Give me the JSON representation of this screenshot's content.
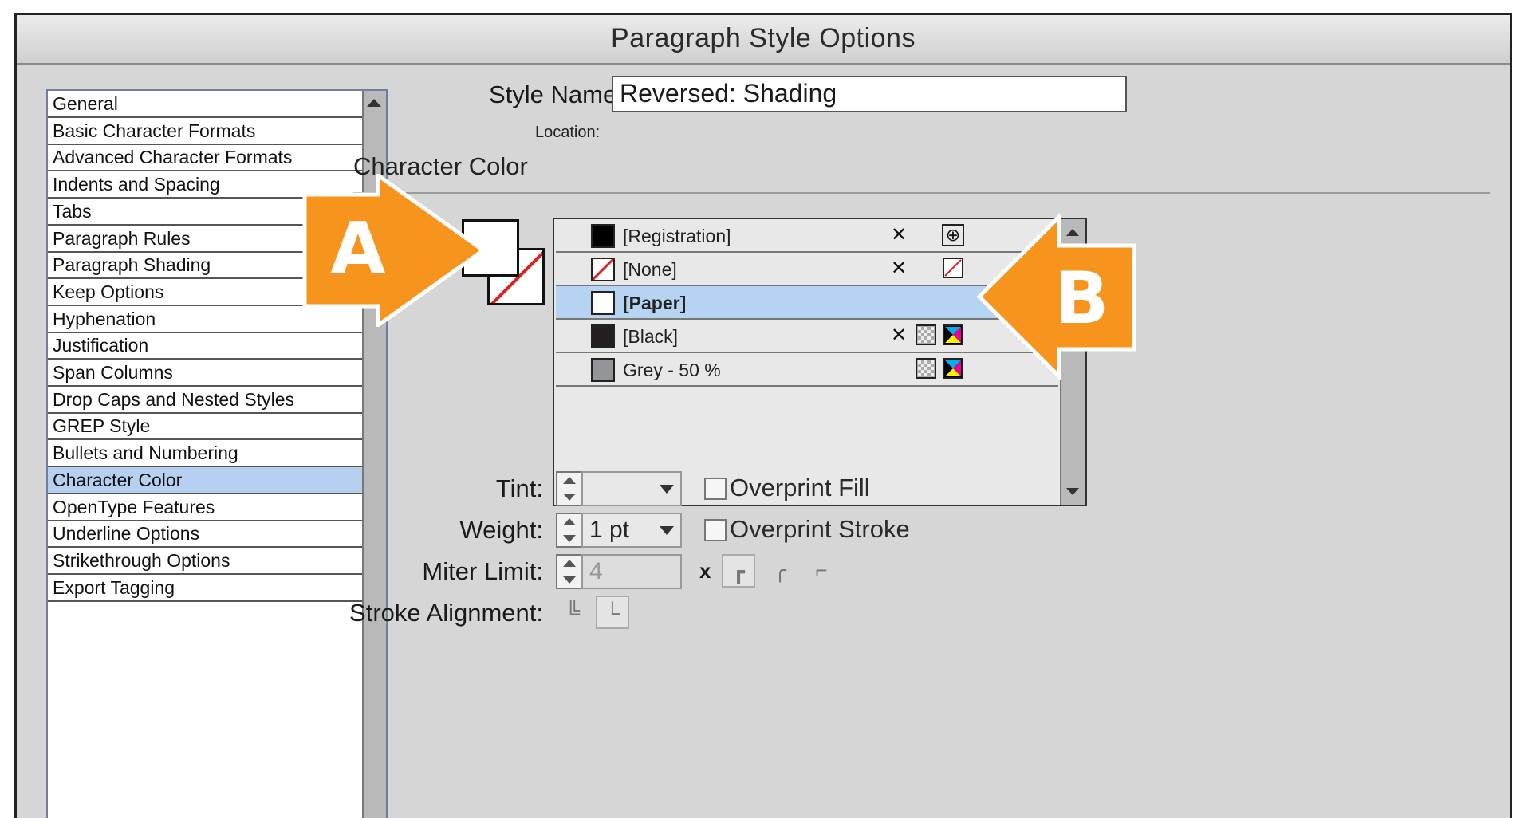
{
  "window": {
    "title": "Paragraph Style Options"
  },
  "sidebar": {
    "items": [
      {
        "label": "General"
      },
      {
        "label": "Basic Character Formats"
      },
      {
        "label": "Advanced Character Formats"
      },
      {
        "label": "Indents and Spacing"
      },
      {
        "label": "Tabs"
      },
      {
        "label": "Paragraph Rules"
      },
      {
        "label": "Paragraph Shading"
      },
      {
        "label": "Keep Options"
      },
      {
        "label": "Hyphenation"
      },
      {
        "label": "Justification"
      },
      {
        "label": "Span Columns"
      },
      {
        "label": "Drop Caps and Nested Styles"
      },
      {
        "label": "GREP Style"
      },
      {
        "label": "Bullets and Numbering"
      },
      {
        "label": "Character Color"
      },
      {
        "label": "OpenType Features"
      },
      {
        "label": "Underline Options"
      },
      {
        "label": "Strikethrough Options"
      },
      {
        "label": "Export Tagging"
      }
    ],
    "selected": "Character Color"
  },
  "header": {
    "style_name_label": "Style Name:",
    "style_name_value": "Reversed: Shading",
    "location_label": "Location:"
  },
  "section": {
    "title": "Character Color"
  },
  "swatches": [
    {
      "name": "[Registration]",
      "color": "#000000"
    },
    {
      "name": "[None]",
      "color": "none"
    },
    {
      "name": "[Paper]",
      "color": "#ffffff",
      "selected": true
    },
    {
      "name": "[Black]",
      "color": "#231f20"
    },
    {
      "name": "Grey - 50 %",
      "color": "#939598"
    }
  ],
  "controls": {
    "tint_label": "Tint:",
    "tint_value": "",
    "weight_label": "Weight:",
    "weight_value": "1 pt",
    "miter_label": "Miter Limit:",
    "miter_value": "4",
    "miter_suffix": "x",
    "stroke_alignment_label": "Stroke Alignment:",
    "overprint_fill": "Overprint Fill",
    "overprint_stroke": "Overprint Stroke"
  },
  "callouts": {
    "a": "A",
    "b": "B",
    "color": "#f7941d"
  },
  "icons": {
    "registration": "registration-target-icon",
    "no_edit": "pencil-crossed-icon",
    "none": "none-swatch-icon",
    "process": "process-color-icon",
    "cmyk": "cmyk-icon"
  }
}
